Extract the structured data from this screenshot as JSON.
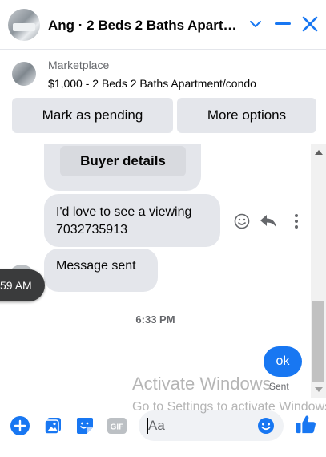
{
  "header": {
    "title": "Ang · 2 Beds 2 Baths Apartm…",
    "icons": [
      "listing-avatar",
      "chevron-down-icon",
      "minimize-icon",
      "close-icon"
    ]
  },
  "listing": {
    "source": "Marketplace",
    "description": "$1,000 - 2 Beds 2 Baths Apartment/condo",
    "mark_pending_label": "Mark as pending",
    "more_options_label": "More options"
  },
  "thread": {
    "time_pill": "59 AM",
    "buyer_details_label": "Buyer details",
    "messages": [
      {
        "text_line1": "I'd love to see a viewing",
        "text_line2": "7032735913"
      },
      {
        "text": "Message sent"
      }
    ],
    "timestamp": "6:33 PM",
    "sent_message": "ok",
    "sent_status": "Sent"
  },
  "watermark": {
    "line1": "Activate Windows",
    "line2": "Go to Settings to activate Windows."
  },
  "composer": {
    "placeholder": "Aa",
    "icons": [
      "plus-icon",
      "photo-icon",
      "sticker-icon",
      "gif-icon",
      "emoji-icon",
      "thumbs-up-icon"
    ]
  },
  "colors": {
    "accent": "#1877f2",
    "bubble": "#e4e6eb",
    "pill": "#3a3b3c"
  }
}
